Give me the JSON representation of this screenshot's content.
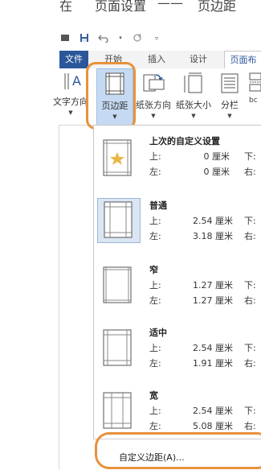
{
  "caption": {
    "part1": "在",
    "part2": "页面设置",
    "part3": "——",
    "part4": "页边距"
  },
  "tabs": {
    "file": "文件",
    "start": "开始",
    "insert": "插入",
    "design": "设计",
    "layout": "页面布"
  },
  "ribbon": {
    "text_direction": "文字方向",
    "margins": "页边距",
    "orientation": "纸张方向",
    "size": "纸张大小",
    "columns": "分栏",
    "text_direction_glyph": "A",
    "partial_glyph": "bc"
  },
  "margins_menu": {
    "items": [
      {
        "title": "上次的自定义设置",
        "top_label": "上:",
        "top": "0 厘米",
        "left_label": "左:",
        "left": "0 厘米",
        "bottom_label": "下:",
        "right_label": "右:"
      },
      {
        "title": "普通",
        "top_label": "上:",
        "top": "2.54 厘米",
        "left_label": "左:",
        "left": "3.18 厘米",
        "bottom_label": "下:",
        "right_label": "右:"
      },
      {
        "title": "窄",
        "top_label": "上:",
        "top": "1.27 厘米",
        "left_label": "左:",
        "left": "1.27 厘米",
        "bottom_label": "下:",
        "right_label": "右:"
      },
      {
        "title": "适中",
        "top_label": "上:",
        "top": "2.54 厘米",
        "left_label": "左:",
        "left": "1.91 厘米",
        "bottom_label": "下:",
        "right_label": "右:"
      },
      {
        "title": "宽",
        "top_label": "上:",
        "top": "2.54 厘米",
        "left_label": "左:",
        "left": "5.08 厘米",
        "bottom_label": "下:",
        "right_label": "右:"
      }
    ],
    "custom_margins": "自定义边距(A)..."
  },
  "colors": {
    "accent": "#2b579a",
    "highlight": "#e8913a",
    "selected": "#c5daf2"
  }
}
